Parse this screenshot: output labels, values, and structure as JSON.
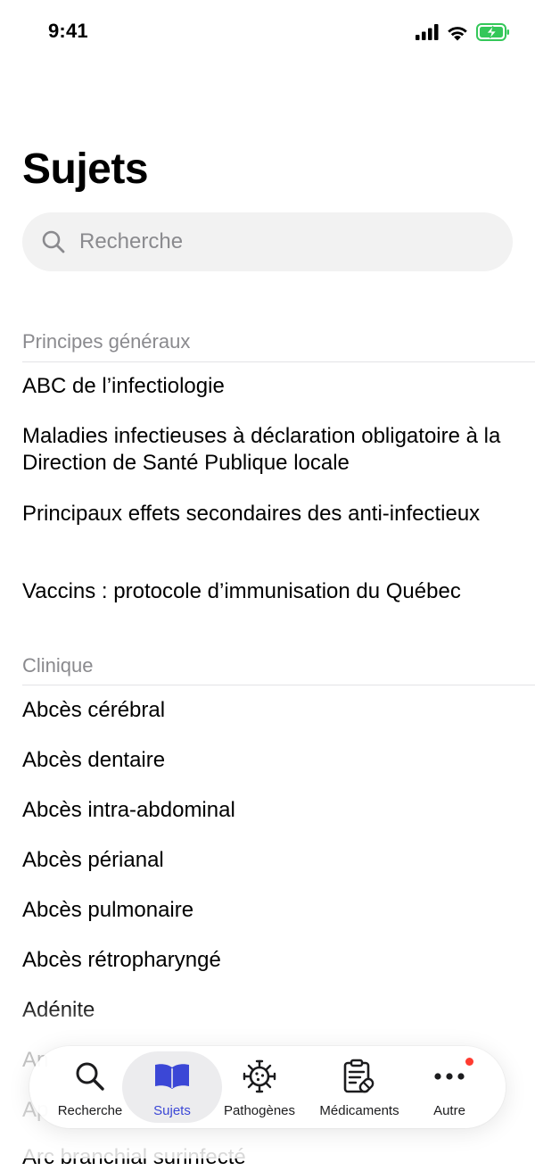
{
  "status_bar": {
    "time": "9:41"
  },
  "page": {
    "title": "Sujets"
  },
  "search": {
    "placeholder": "Recherche"
  },
  "sections": [
    {
      "header": "Principes généraux",
      "items": [
        "ABC de l’infectiologie",
        "Maladies infectieuses à déclaration obligatoire à la Direction de Santé Publique locale",
        "Principaux effets secondaires des anti-infectieux",
        "Vaccins : protocole d’immunisation du Québec"
      ]
    },
    {
      "header": "Clinique",
      "items": [
        "Abcès cérébral",
        "Abcès dentaire",
        "Abcès intra-abdominal",
        "Abcès périanal",
        "Abcès pulmonaire",
        "Abcès rétropharyngé",
        "Adénite",
        "An",
        "Ap",
        "Arc branchial surinfecté"
      ]
    }
  ],
  "tab_bar": {
    "tabs": [
      {
        "label": "Recherche",
        "icon": "search-icon",
        "active": false
      },
      {
        "label": "Sujets",
        "icon": "book-icon",
        "active": true
      },
      {
        "label": "Pathogènes",
        "icon": "virus-icon",
        "active": false
      },
      {
        "label": "Médicaments",
        "icon": "prescription-icon",
        "active": false
      },
      {
        "label": "Autre",
        "icon": "more-icon",
        "active": false,
        "badge": true
      }
    ]
  },
  "colors": {
    "accent": "#3b47d6",
    "badge": "#ff3b30",
    "secondary_text": "#8a8a8e",
    "search_background": "#f2f2f2"
  }
}
